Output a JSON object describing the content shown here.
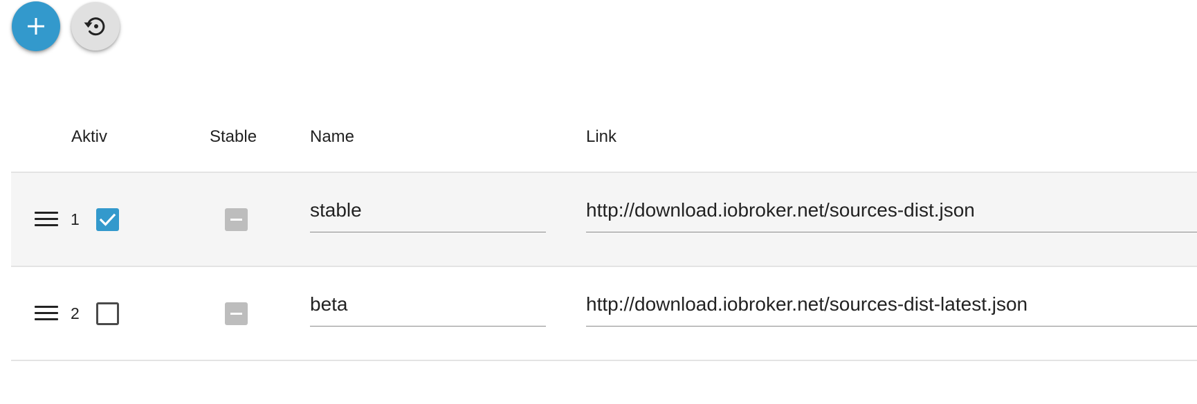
{
  "toolbar": {
    "add_icon": "plus-icon",
    "reset_icon": "restore-icon",
    "add_color": "#3399cc"
  },
  "table": {
    "headers": {
      "aktiv": "Aktiv",
      "stable": "Stable",
      "name": "Name",
      "link": "Link"
    },
    "rows": [
      {
        "index": "1",
        "active": true,
        "stable": "indeterminate",
        "name": "stable",
        "link": "http://download.iobroker.net/sources-dist.json"
      },
      {
        "index": "2",
        "active": false,
        "stable": "indeterminate",
        "name": "beta",
        "link": "http://download.iobroker.net/sources-dist-latest.json"
      }
    ]
  }
}
